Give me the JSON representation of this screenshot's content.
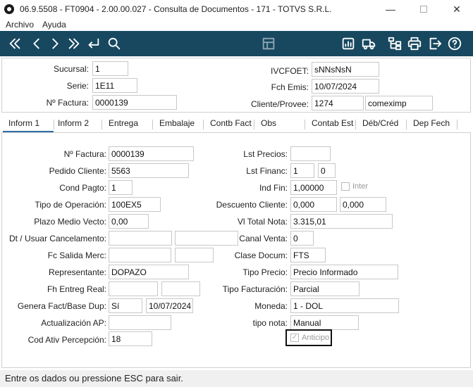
{
  "window": {
    "title": "06.9.5508 - FT0904 - 2.00.00.027 - Consulta de Documentos - 171 - TOTVS S.R.L."
  },
  "menu": [
    "Archivo",
    "Ayuda"
  ],
  "toolbar_icons": [
    "first-icon",
    "previous-icon",
    "next-icon",
    "last-icon",
    "return-icon",
    "search-icon",
    "layout-icon",
    "report-icon",
    "truck-icon",
    "tree-icon",
    "print-icon",
    "exit-icon",
    "help-icon"
  ],
  "header": {
    "sucursal": {
      "label": "Sucursal:",
      "value": "1"
    },
    "serie": {
      "label": "Serie:",
      "value": "1E11"
    },
    "factura": {
      "label": "Nº Factura:",
      "value": "0000139"
    },
    "ivcfoet": {
      "label": "IVCFOET:",
      "value": "sNNsNsN"
    },
    "fch_emis": {
      "label": "Fch Emis:",
      "value": "10/07/2024"
    },
    "cliente": {
      "label": "Cliente/Provee:",
      "code": "1274",
      "name": "comeximp"
    }
  },
  "tabs": [
    "Inform 1",
    "Inform 2",
    "Entrega",
    "Embalaje",
    "Contb Fact",
    "Obs",
    "Contab Est",
    "Déb/Créd",
    "Dep Fech"
  ],
  "left": {
    "factura": {
      "label": "Nº Factura:",
      "value": "0000139"
    },
    "pedido": {
      "label": "Pedido Cliente:",
      "value": "5563"
    },
    "cond_pagto": {
      "label": "Cond Pagto:",
      "value": "1"
    },
    "tipo_oper": {
      "label": "Tipo de Operación:",
      "value": "100EX5"
    },
    "plazo": {
      "label": "Plazo Medio Vecto:",
      "value": "0,00"
    },
    "dt_usuar": {
      "label": "Dt / Usuar Cancelamento:",
      "value1": "",
      "value2": ""
    },
    "fc_salida": {
      "label": "Fc Salida Merc:",
      "value1": "",
      "value2": ""
    },
    "representante": {
      "label": "Representante:",
      "value": "DOPAZO"
    },
    "fh_entreg": {
      "label": "Fh Entreg Real:",
      "value1": "",
      "value2": ""
    },
    "genera": {
      "label": "Genera Fact/Base Dup:",
      "value1": "Sí",
      "value2": "10/07/2024"
    },
    "actualizacion": {
      "label": "Actualización AP:",
      "value": ""
    },
    "cod_ativ": {
      "label": "Cod Ativ Percepción:",
      "value": "18"
    }
  },
  "right": {
    "lst_precios": {
      "label": "Lst Precios:",
      "value": ""
    },
    "lst_financ": {
      "label": "Lst Financ:",
      "value1": "1",
      "value2": "0"
    },
    "ind_fin": {
      "label": "Ind Fin:",
      "value": "1,00000",
      "check_label": "Inter"
    },
    "descuento": {
      "label": "Descuento Cliente:",
      "value1": "0,000",
      "value2": "0,000"
    },
    "vl_total": {
      "label": "Vl Total Nota:",
      "value": "3.315,01"
    },
    "canal": {
      "label": "Canal Venta:",
      "value": "0"
    },
    "clase": {
      "label": "Clase Docum:",
      "value": "FTS"
    },
    "tipo_precio": {
      "label": "Tipo Precio:",
      "value": "Precio Informado"
    },
    "tipo_fact": {
      "label": "Tipo Facturación:",
      "value": "Parcial"
    },
    "moneda": {
      "label": "Moneda:",
      "value": "1 - DOL"
    },
    "tipo_nota": {
      "label": "tipo nota:",
      "value": "Manual"
    },
    "anticipo": {
      "label": "Anticipo",
      "checked": true
    }
  },
  "status": "Entre os dados ou pressione ESC para sair."
}
